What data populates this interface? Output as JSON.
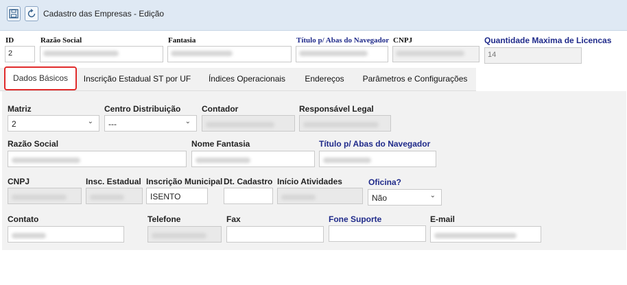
{
  "header": {
    "title": "Cadastro das Empresas - Edição",
    "save_icon": "save-icon",
    "refresh_icon": "refresh-icon"
  },
  "top_fields": {
    "id_label": "ID",
    "id_value": "2",
    "razao_label": "Razão Social",
    "fantasia_label": "Fantasia",
    "titulo_label": "Título p/ Abas do Navegador",
    "cnpj_label": "CNPJ",
    "licencas_label": "Quantidade Maxima de Licencas",
    "licencas_value": "14"
  },
  "tabs": [
    {
      "label": "Dados Básicos",
      "active": true
    },
    {
      "label": "Inscrição Estadual ST por UF"
    },
    {
      "label": "Índices Operacionais"
    },
    {
      "label": "Endereços"
    },
    {
      "label": "Parâmetros e Configurações"
    }
  ],
  "form": {
    "matriz_label": "Matriz",
    "matriz_value": "2",
    "centro_label": "Centro Distribuição",
    "centro_value": "---",
    "contador_label": "Contador",
    "responsavel_label": "Responsável Legal",
    "razao_label": "Razão Social",
    "nome_fantasia_label": "Nome Fantasia",
    "titulo_label": "Título p/ Abas do Navegador",
    "cnpj_label": "CNPJ",
    "insc_estadual_label": "Insc. Estadual",
    "insc_municipal_label": "Inscrição Municipal",
    "insc_municipal_value": "ISENTO",
    "dt_cadastro_label": "Dt. Cadastro",
    "inicio_label": "Início Atividades",
    "oficina_label": "Oficina?",
    "oficina_value": "Não",
    "contato_label": "Contato",
    "telefone_label": "Telefone",
    "fax_label": "Fax",
    "fone_suporte_label": "Fone Suporte",
    "email_label": "E-mail"
  },
  "colors": {
    "titlebar_bg": "#dfe9f4",
    "blue_label": "#1f2a8a",
    "active_tab_border": "#e02a2a"
  }
}
